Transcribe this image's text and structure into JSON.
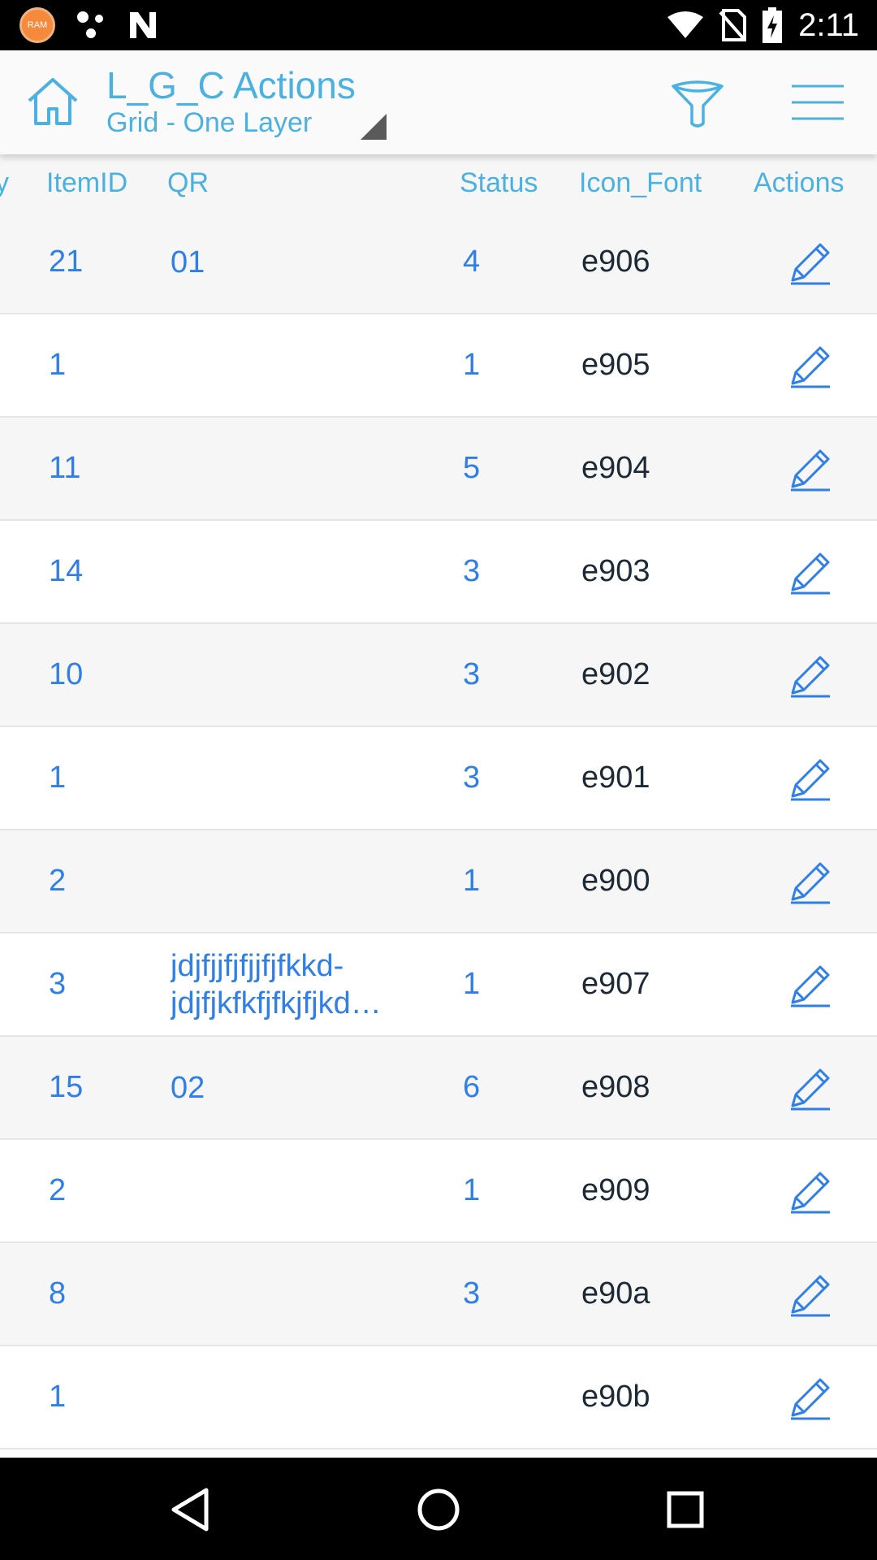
{
  "status_bar": {
    "ram_label": "RAM",
    "time": "2:11",
    "icons": [
      "ram-icon",
      "dots-icon",
      "n-icon",
      "wifi-icon",
      "no-sim-icon",
      "battery-charging-icon"
    ]
  },
  "app_bar": {
    "title": "L_G_C Actions",
    "subtitle": "Grid - One Layer",
    "icons": [
      "home-icon",
      "dropdown-triangle-icon",
      "filter-icon",
      "menu-icon"
    ]
  },
  "table": {
    "columns": {
      "cutoff": "y",
      "item_id": "ItemID",
      "qr": "QR",
      "status": "Status",
      "icon_font": "Icon_Font",
      "actions": "Actions"
    },
    "rows": [
      {
        "item_id": "21",
        "qr": [
          "01"
        ],
        "status": "4",
        "icon_font": "e906"
      },
      {
        "item_id": "1",
        "qr": [],
        "status": "1",
        "icon_font": "e905"
      },
      {
        "item_id": "11",
        "qr": [],
        "status": "5",
        "icon_font": "e904"
      },
      {
        "item_id": "14",
        "qr": [],
        "status": "3",
        "icon_font": "e903"
      },
      {
        "item_id": "10",
        "qr": [],
        "status": "3",
        "icon_font": "e902"
      },
      {
        "item_id": "1",
        "qr": [],
        "status": "3",
        "icon_font": "e901"
      },
      {
        "item_id": "2",
        "qr": [],
        "status": "1",
        "icon_font": "e900"
      },
      {
        "item_id": "3",
        "qr": [
          "jdjfjjfjfjjfjfkkd-",
          "jdjfjkfkfjfkjfjkd…"
        ],
        "status": "1",
        "icon_font": "e907"
      },
      {
        "item_id": "15",
        "qr": [
          "02"
        ],
        "status": "6",
        "icon_font": "e908"
      },
      {
        "item_id": "2",
        "qr": [],
        "status": "1",
        "icon_font": "e909"
      },
      {
        "item_id": "8",
        "qr": [],
        "status": "3",
        "icon_font": "e90a"
      },
      {
        "item_id": "1",
        "qr": [],
        "status": "",
        "icon_font": "e90b"
      }
    ],
    "action_icon": "edit-pencil-icon"
  },
  "nav_bar": {
    "icons": [
      "back-icon",
      "home-circle-icon",
      "recents-icon"
    ]
  },
  "colors": {
    "accent": "#4ab1e0",
    "link": "#2f7fe6",
    "text": "#1d2a36",
    "row_alt": "#f6f6f6"
  }
}
